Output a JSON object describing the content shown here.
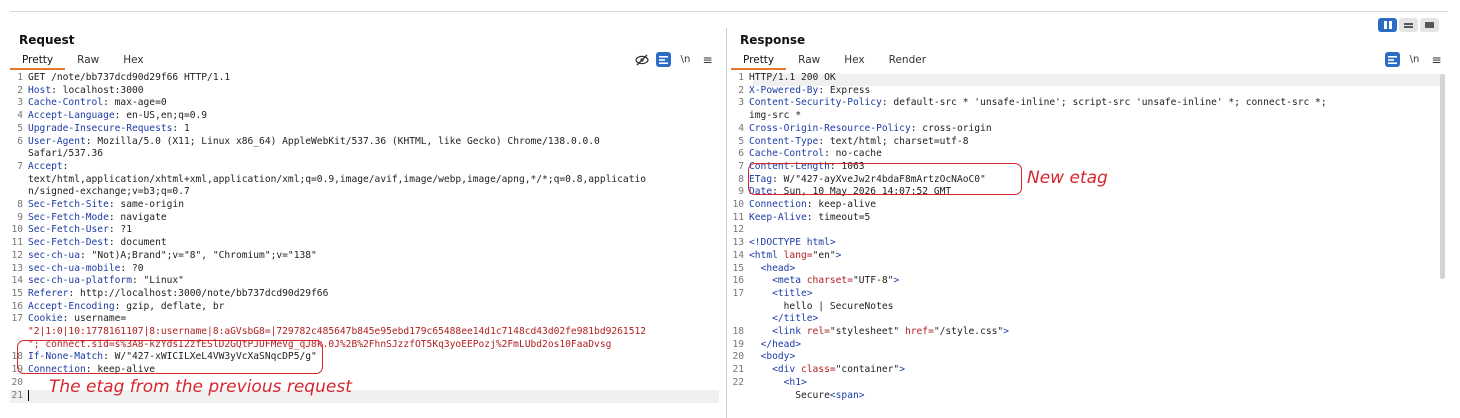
{
  "layout_toggle": {
    "active": 0
  },
  "request": {
    "title": "Request",
    "tabs": [
      "Pretty",
      "Raw",
      "Hex"
    ],
    "active_tab": 0,
    "icons": {
      "hide": "eye-slash-icon",
      "toggle": "list-icon",
      "newline": "\\n",
      "menu": "≡"
    },
    "lines": [
      {
        "n": "1",
        "k": "",
        "v": "GET /note/bb737dcd90d29f66 HTTP/1.1"
      },
      {
        "n": "2",
        "k": "Host",
        "v": " localhost:3000"
      },
      {
        "n": "3",
        "k": "Cache-Control",
        "v": " max-age=0"
      },
      {
        "n": "4",
        "k": "Accept-Language",
        "v": " en-US,en;q=0.9"
      },
      {
        "n": "5",
        "k": "Upgrade-Insecure-Requests",
        "v": " 1"
      },
      {
        "n": "6",
        "k": "User-Agent",
        "v": " Mozilla/5.0 (X11; Linux x86_64) AppleWebKit/537.36 (KHTML, like Gecko) Chrome/138.0.0.0"
      },
      {
        "n": "",
        "k": "",
        "v": "Safari/537.36"
      },
      {
        "n": "7",
        "k": "Accept",
        "v": ""
      },
      {
        "n": "",
        "k": "",
        "v": "text/html,application/xhtml+xml,application/xml;q=0.9,image/avif,image/webp,image/apng,*/*;q=0.8,applicatio"
      },
      {
        "n": "",
        "k": "",
        "v": "n/signed-exchange;v=b3;q=0.7"
      },
      {
        "n": "8",
        "k": "Sec-Fetch-Site",
        "v": " same-origin"
      },
      {
        "n": "9",
        "k": "Sec-Fetch-Mode",
        "v": " navigate"
      },
      {
        "n": "10",
        "k": "Sec-Fetch-User",
        "v": " ?1"
      },
      {
        "n": "11",
        "k": "Sec-Fetch-Dest",
        "v": " document"
      },
      {
        "n": "12",
        "k": "sec-ch-ua",
        "v": " \"Not)A;Brand\";v=\"8\", \"Chromium\";v=\"138\""
      },
      {
        "n": "13",
        "k": "sec-ch-ua-mobile",
        "v": " ?0"
      },
      {
        "n": "14",
        "k": "sec-ch-ua-platform",
        "v": " \"Linux\""
      },
      {
        "n": "15",
        "k": "Referer",
        "v": " http://localhost:3000/note/bb737dcd90d29f66"
      },
      {
        "n": "16",
        "k": "Accept-Encoding",
        "v": " gzip, deflate, br"
      },
      {
        "n": "17",
        "k": "Cookie",
        "v": " username=",
        "red": false
      },
      {
        "n": "",
        "k": "",
        "v": "\"2|1:0|10:1778161107|8:username|8:aGVsbG8=|729782c485647b845e95ebd179c65488ee14d1c7148cd43d02fe981bd9261512",
        "red": true
      },
      {
        "n": "",
        "k": "",
        "v": "\"; connect.sid=s%3A8-kzYdsI2zfESlD2GQtPJUFMeVg_qJ8k.0J%2B%2FhnSJzzfOT5Kq3yoEEPozj%2FmLUbd2os10FaaDvsg",
        "red": true
      },
      {
        "n": "18",
        "k": "If-None-Match",
        "v": " W/\"427-xWICILXeL4VW3yVcXaSNqcDP5/g\""
      },
      {
        "n": "19",
        "k": "Connection",
        "v": " keep-alive"
      },
      {
        "n": "20",
        "k": "",
        "v": ""
      },
      {
        "n": "21",
        "k": "",
        "v": "",
        "cursor": true
      }
    ],
    "annotation": "The etag from the previous request"
  },
  "response": {
    "title": "Response",
    "tabs": [
      "Pretty",
      "Raw",
      "Hex",
      "Render"
    ],
    "active_tab": 0,
    "icons": {
      "toggle": "list-icon",
      "newline": "\\n",
      "menu": "≡"
    },
    "lines": [
      {
        "n": "1",
        "k": "",
        "v": "HTTP/1.1 200 OK"
      },
      {
        "n": "2",
        "k": "X-Powered-By",
        "v": " Express"
      },
      {
        "n": "3",
        "k": "Content-Security-Policy",
        "v": " default-src * 'unsafe-inline'; script-src 'unsafe-inline' *; connect-src *;"
      },
      {
        "n": "",
        "k": "",
        "v": "img-src *"
      },
      {
        "n": "4",
        "k": "Cross-Origin-Resource-Policy",
        "v": " cross-origin"
      },
      {
        "n": "5",
        "k": "Content-Type",
        "v": " text/html; charset=utf-8"
      },
      {
        "n": "6",
        "k": "Cache-Control",
        "v": " no-cache"
      },
      {
        "n": "7",
        "k": "Content-Length",
        "v": " 1063"
      },
      {
        "n": "8",
        "k": "ETag",
        "v": " W/\"427-ayXveJw2r4bdaF8mArtzOcNAoC0\""
      },
      {
        "n": "9",
        "k": "Date",
        "v": " Sun, 10 May 2026 14:07:52 GMT"
      },
      {
        "n": "10",
        "k": "Connection",
        "v": " keep-alive"
      },
      {
        "n": "11",
        "k": "Keep-Alive",
        "v": " timeout=5"
      },
      {
        "n": "12",
        "k": "",
        "v": ""
      },
      {
        "n": "13",
        "html": [
          [
            "tag",
            "<!DOCTYPE html>"
          ]
        ]
      },
      {
        "n": "14",
        "html": [
          [
            "tag",
            "<html "
          ],
          [
            "attr",
            "lang="
          ],
          [
            "txt",
            "\"en\""
          ],
          [
            "tag",
            ">"
          ]
        ]
      },
      {
        "n": "15",
        "html": [
          [
            "txt",
            "  "
          ],
          [
            "tag",
            "<head>"
          ]
        ]
      },
      {
        "n": "16",
        "html": [
          [
            "txt",
            "    "
          ],
          [
            "tag",
            "<meta "
          ],
          [
            "attr",
            "charset="
          ],
          [
            "txt",
            "\"UTF-8\""
          ],
          [
            "tag",
            ">"
          ]
        ]
      },
      {
        "n": "17",
        "html": [
          [
            "txt",
            "    "
          ],
          [
            "tag",
            "<title>"
          ]
        ]
      },
      {
        "n": "",
        "html": [
          [
            "txt",
            "      hello | SecureNotes"
          ]
        ]
      },
      {
        "n": "",
        "html": [
          [
            "txt",
            "    "
          ],
          [
            "tag",
            "</title>"
          ]
        ]
      },
      {
        "n": "18",
        "html": [
          [
            "txt",
            "    "
          ],
          [
            "tag",
            "<link "
          ],
          [
            "attr",
            "rel="
          ],
          [
            "txt",
            "\"stylesheet\" "
          ],
          [
            "attr",
            "href="
          ],
          [
            "txt",
            "\"/style.css\""
          ],
          [
            "tag",
            ">"
          ]
        ]
      },
      {
        "n": "19",
        "html": [
          [
            "txt",
            "  "
          ],
          [
            "tag",
            "</head>"
          ]
        ]
      },
      {
        "n": "20",
        "html": [
          [
            "txt",
            "  "
          ],
          [
            "tag",
            "<body>"
          ]
        ]
      },
      {
        "n": "21",
        "html": [
          [
            "txt",
            "    "
          ],
          [
            "tag",
            "<div "
          ],
          [
            "attr",
            "class="
          ],
          [
            "txt",
            "\"container\""
          ],
          [
            "tag",
            ">"
          ]
        ]
      },
      {
        "n": "22",
        "html": [
          [
            "txt",
            "      "
          ],
          [
            "tag",
            "<h1>"
          ]
        ]
      },
      {
        "n": "",
        "html": [
          [
            "txt",
            "        Secure"
          ],
          [
            "tag",
            "<span>"
          ]
        ]
      }
    ],
    "annotation": "New etag"
  },
  "colors": {
    "accent": "#2b6cc4",
    "tab_underline": "#e8782e",
    "annotation": "#d6262e",
    "header_key": "#1d3ca6",
    "cookie_value": "#b21e1e"
  }
}
